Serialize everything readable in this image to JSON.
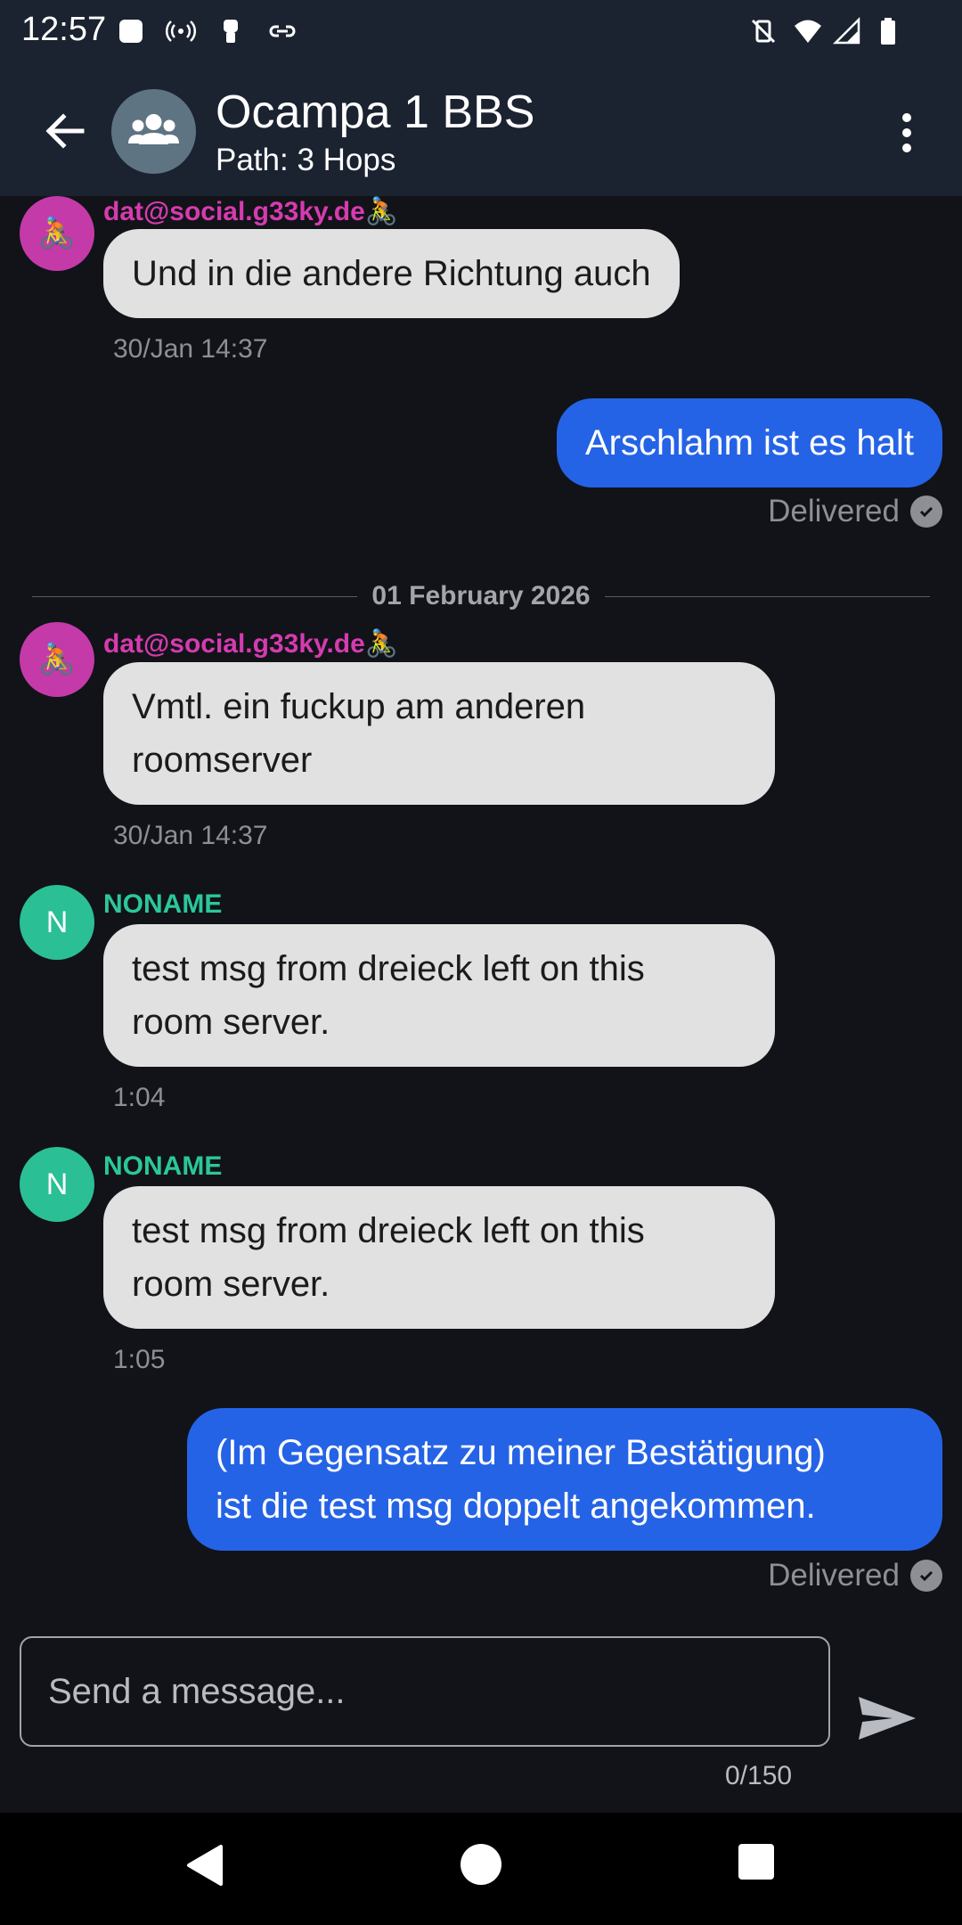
{
  "status_bar": {
    "time": "12:57"
  },
  "header": {
    "title": "Ocampa 1 BBS",
    "subtitle": "Path: 3 Hops"
  },
  "messages": [
    {
      "sender": "dat@social.g33ky.de🚴",
      "text": "Und in die andere Richtung auch",
      "time": "30/Jan 14:37"
    },
    {
      "text": "Arschlahm ist es halt",
      "status": "Delivered"
    },
    {
      "date": "01 February 2026"
    },
    {
      "sender": "dat@social.g33ky.de🚴",
      "text_line1": "Vmtl. ein fuckup am anderen",
      "text_line2": "roomserver",
      "time": "30/Jan 14:37"
    },
    {
      "sender": "NONAME",
      "avatar_letter": "N",
      "text_line1": "test msg from dreieck left on this",
      "text_line2": "room server.",
      "time": "1:04"
    },
    {
      "sender": "NONAME",
      "avatar_letter": "N",
      "text_line1": "test msg from dreieck left on this",
      "text_line2": "room server.",
      "time": "1:05"
    },
    {
      "text_line1": "(Im Gegensatz zu meiner Bestätigung)",
      "text_line2": "ist die test msg doppelt angekommen.",
      "status": "Delivered"
    }
  ],
  "composer": {
    "placeholder": "Send a message...",
    "counter": "0/150"
  },
  "colors": {
    "incoming_bubble": "#e1e1e1",
    "outgoing_bubble": "#2563e6",
    "pink_sender": "#d63bb0",
    "green_sender": "#2bc79b"
  }
}
